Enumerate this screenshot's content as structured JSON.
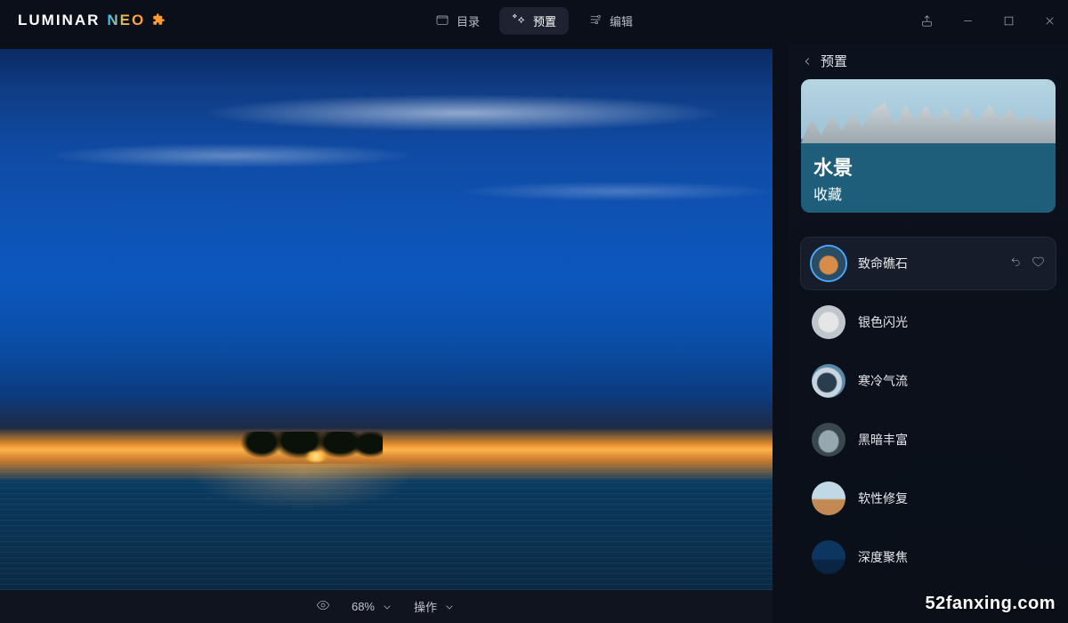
{
  "app": {
    "name_part1": "LUMINAR",
    "name_part2": "NEO"
  },
  "nav": {
    "catalog": "目录",
    "presets": "预置",
    "edit": "编辑"
  },
  "footer": {
    "zoom": "68%",
    "operations": "操作"
  },
  "sidebar": {
    "back_label": "预置",
    "hero_title": "水景",
    "hero_subtitle": "收藏",
    "presets": [
      {
        "label": "致命礁石",
        "selected": true,
        "thumb": "t1"
      },
      {
        "label": "银色闪光",
        "selected": false,
        "thumb": "t2"
      },
      {
        "label": "寒冷气流",
        "selected": false,
        "thumb": "t3"
      },
      {
        "label": "黑暗丰富",
        "selected": false,
        "thumb": "t4"
      },
      {
        "label": "软性修复",
        "selected": false,
        "thumb": "t5"
      },
      {
        "label": "深度聚焦",
        "selected": false,
        "thumb": "t6"
      }
    ]
  },
  "watermark": "52fanxing.com"
}
